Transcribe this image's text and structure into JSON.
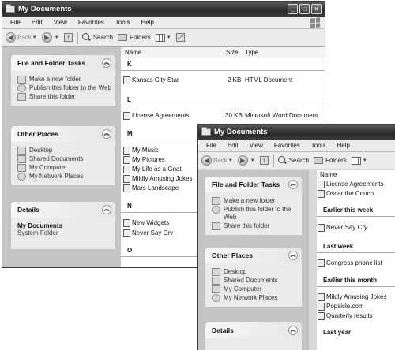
{
  "window1": {
    "title": "My Documents",
    "menu": [
      "File",
      "Edit",
      "View",
      "Favorites",
      "Tools",
      "Help"
    ],
    "toolbar": {
      "back": "Back",
      "search": "Search",
      "folders": "Folders"
    },
    "tasks": {
      "file_folder": {
        "title": "File and Folder Tasks",
        "items": [
          "Make a new folder",
          "Publish this folder to the Web",
          "Share this folder"
        ]
      },
      "other_places": {
        "title": "Other Places",
        "items": [
          "Desktop",
          "Shared Documents",
          "My Computer",
          "My Network Places"
        ]
      },
      "details": {
        "title": "Details",
        "name": "My Documents",
        "type": "System Folder"
      }
    },
    "columns": {
      "name": "Name",
      "size": "Size",
      "type": "Type"
    },
    "groups": [
      {
        "letter": "K",
        "files": [
          {
            "name": "Kansas City Star",
            "size": "2 KB",
            "type": "HTML Document"
          }
        ]
      },
      {
        "letter": "L",
        "files": [
          {
            "name": "License Agreements",
            "size": "30 KB",
            "type": "Microsoft Word Document"
          }
        ]
      },
      {
        "letter": "M",
        "files": [
          {
            "name": "My Music"
          },
          {
            "name": "My Pictures"
          },
          {
            "name": "My Life as a Gnat"
          },
          {
            "name": "Mildly Amusing Jokes"
          },
          {
            "name": "Mars Landscape"
          }
        ]
      },
      {
        "letter": "N",
        "files": [
          {
            "name": "New Widgets"
          },
          {
            "name": "Never Say Cry"
          }
        ]
      },
      {
        "letter": "O",
        "files": []
      }
    ]
  },
  "window2": {
    "title": "My Documents",
    "menu": [
      "File",
      "Edit",
      "View",
      "Favorites",
      "Tools",
      "Help"
    ],
    "toolbar": {
      "back": "Back",
      "search": "Search",
      "folders": "Folders"
    },
    "tasks": {
      "file_folder": {
        "title": "File and Folder Tasks",
        "items": [
          "Make a new folder",
          "Publish this folder to the Web",
          "Share this folder"
        ]
      },
      "other_places": {
        "title": "Other Places",
        "items": [
          "Desktop",
          "Shared Documents",
          "My Computer",
          "My Network Places"
        ]
      },
      "details": {
        "title": "Details"
      }
    },
    "columns": {
      "name": "Name"
    },
    "top_files": [
      "License Agreements",
      "Oscar the Couch"
    ],
    "groups": [
      {
        "label": "Earlier this week",
        "files": [
          "Never Say Cry"
        ]
      },
      {
        "label": "Last week",
        "files": [
          "Congress phone list"
        ]
      },
      {
        "label": "Earlier this month",
        "files": [
          "Mildly Amusing Jokes",
          "Popsicle.com",
          "Quarterly results"
        ]
      },
      {
        "label": "Last year",
        "files": []
      }
    ]
  }
}
